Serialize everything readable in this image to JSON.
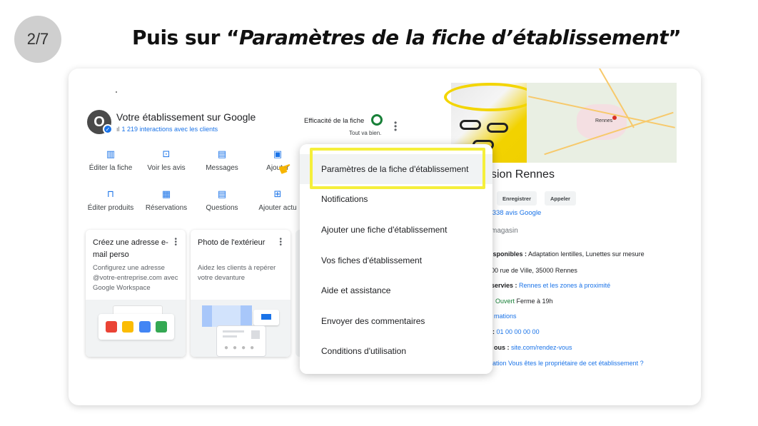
{
  "step": "2/7",
  "heading": {
    "prefix": "Puis sur “",
    "emphasis": "Paramètres de la fiche d’établissement",
    "suffix": "”"
  },
  "business": {
    "avatar_letter": "O",
    "title": "Votre établissement sur Google",
    "interactions": "1 219 interactions avec les clients",
    "efficiency_label": "Efficacité de la fiche",
    "efficiency_status": "Tout va bien."
  },
  "actions_row1": [
    {
      "label": "Éditer la fiche",
      "icon": "storefront-icon"
    },
    {
      "label": "Voir les avis",
      "icon": "star-review-icon"
    },
    {
      "label": "Messages",
      "icon": "message-icon"
    },
    {
      "label": "Ajouter",
      "icon": "photo-icon"
    }
  ],
  "actions_row2": [
    {
      "label": "Éditer produits",
      "icon": "shopping-bag-icon"
    },
    {
      "label": "Réservations",
      "icon": "calendar-icon"
    },
    {
      "label": "Questions",
      "icon": "question-icon"
    },
    {
      "label": "Ajouter actu",
      "icon": "post-icon"
    }
  ],
  "cards": [
    {
      "title": "Créez une adresse e-mail perso",
      "desc": "Configurez une adresse @votre-entreprise.com avec Google Workspace"
    },
    {
      "title": "Photo de l'extérieur",
      "desc": "Aidez les clients à repérer votre devanture"
    }
  ],
  "menu": {
    "items": [
      "Paramètres de la fiche d'établissement",
      "Notifications",
      "Ajouter une fiche d'établissement",
      "Vos fiches d'établissement",
      "Aide et assistance",
      "Envoyer des commentaires",
      "Conditions d'utilisation"
    ]
  },
  "shop": {
    "title": "sion Rennes",
    "save_label": "Enregistrer",
    "call_label": "Appeler",
    "stars": "★★",
    "reviews": "338 avis Google",
    "category": "magasin",
    "rows": [
      {
        "label": "isponibles :",
        "value": "Adaptation lentilles, Lunettes sur mesure"
      },
      {
        "label": "",
        "value": "00 rue de Ville, 35000 Rennes"
      },
      {
        "label": "servies :",
        "value": "Rennes et les zones à proximité"
      },
      {
        "label": "",
        "value": "Ouvert",
        "extra": "Ferme à 19h"
      },
      {
        "label": "",
        "value": "mations"
      },
      {
        "label": ":",
        "value": "01 00 00 00 00"
      },
      {
        "label": "ous :",
        "value": "site.com/rendez-vous"
      },
      {
        "label": "",
        "value": "une modification Vous êtes le propriétaire de cet établissement ?"
      }
    ],
    "map_label": "Rennes"
  },
  "colors": {
    "accent": "#1a73e8",
    "highlight": "#f5ef3b",
    "green": "#188038"
  }
}
